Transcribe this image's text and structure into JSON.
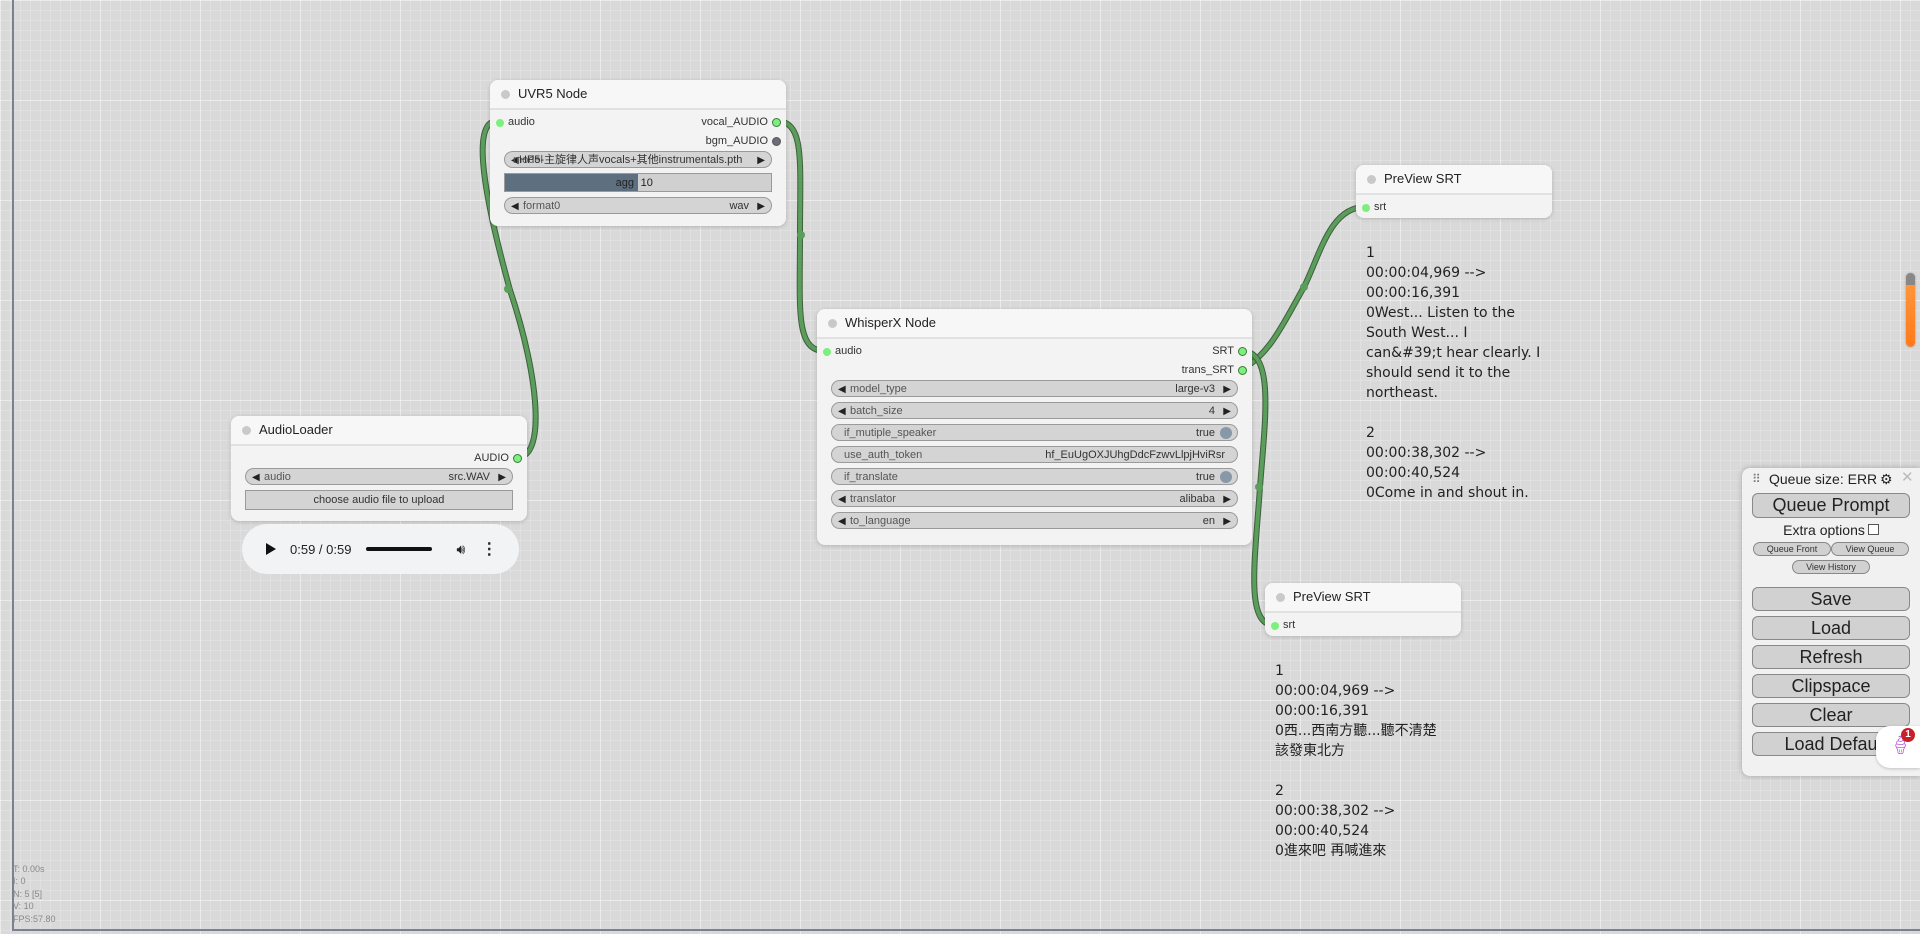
{
  "nodes": {
    "uvr5": {
      "title": "UVR5 Node",
      "inputs": [
        {
          "label": "audio"
        }
      ],
      "outputs": [
        {
          "label": "vocal_AUDIO"
        },
        {
          "label": "bgm_AUDIO"
        }
      ],
      "widgets": {
        "model": {
          "label": "model",
          "value": "HP5-主旋律人声vocals+其他instrumentals.pth"
        },
        "agg": {
          "label": "agg",
          "value": "10",
          "fraction": 0.5
        },
        "format": {
          "label": "format0",
          "value": "wav"
        }
      }
    },
    "audio_loader": {
      "title": "AudioLoader",
      "outputs": [
        {
          "label": "AUDIO"
        }
      ],
      "widgets": {
        "audio": {
          "label": "audio",
          "value": "src.WAV"
        },
        "upload_label": "choose audio file to upload"
      },
      "player": {
        "time": "0:59 / 0:59",
        "progress": 1.0
      }
    },
    "whisperx": {
      "title": "WhisperX Node",
      "inputs": [
        {
          "label": "audio"
        }
      ],
      "outputs": [
        {
          "label": "SRT"
        },
        {
          "label": "trans_SRT"
        }
      ],
      "widgets": [
        {
          "label": "model_type",
          "value": "large-v3",
          "kind": "combo"
        },
        {
          "label": "batch_size",
          "value": "4",
          "kind": "number"
        },
        {
          "label": "if_mutiple_speaker",
          "value": "true",
          "kind": "toggle"
        },
        {
          "label": "use_auth_token",
          "value": "hf_EuUgOXJUhgDdcFzwvLlpjHviRsr",
          "kind": "text"
        },
        {
          "label": "if_translate",
          "value": "true",
          "kind": "toggle"
        },
        {
          "label": "translator",
          "value": "alibaba",
          "kind": "combo"
        },
        {
          "label": "to_language",
          "value": "en",
          "kind": "combo"
        }
      ]
    },
    "preview_top": {
      "title": "PreView SRT",
      "inputs": [
        {
          "label": "srt"
        }
      ],
      "output_text": "1\n00:00:04,969 -->\n00:00:16,391\n0West... Listen to the\nSouth West... I\ncan&#39;t hear clearly. I\nshould send it to the\nnortheast.\n\n2\n00:00:38,302 -->\n00:00:40,524\n0Come in and shout in."
    },
    "preview_bottom": {
      "title": "PreView SRT",
      "inputs": [
        {
          "label": "srt"
        }
      ],
      "output_text": "1\n00:00:04,969 -->\n00:00:16,391\n0西...西南方聽...聽不清楚\n該發東北方\n\n2\n00:00:38,302 -->\n00:00:40,524\n0進來吧 再喊進來"
    }
  },
  "stats": {
    "t": "T: 0.00s",
    "i": "I: 0",
    "n": "N: 5 [5]",
    "v": "V: 10",
    "fps": "FPS:57.80"
  },
  "menu": {
    "queue_size": "Queue size: ERR",
    "queue_prompt": "Queue Prompt",
    "extra_options": "Extra options",
    "extra_options_checked": false,
    "queue_front": "Queue Front",
    "view_queue": "View Queue",
    "view_history": "View History",
    "save": "Save",
    "load": "Load",
    "refresh": "Refresh",
    "clipspace": "Clipspace",
    "clear": "Clear",
    "load_default": "Load Defau"
  },
  "notification": {
    "count": "1"
  },
  "colors": {
    "link": "#5b9d5b",
    "slot_connected": "#7cf07c",
    "scroll_thumb": "#ff8a2a"
  }
}
